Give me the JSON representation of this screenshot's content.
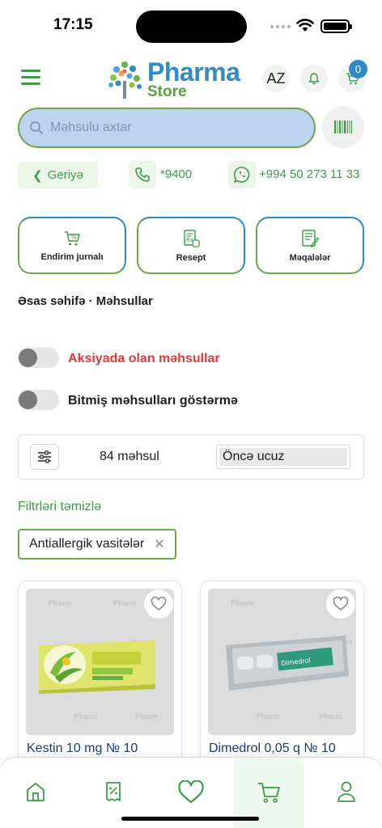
{
  "status_bar": {
    "time": "17:15"
  },
  "header": {
    "logo_line1": "Pharma",
    "logo_line2": "Store",
    "lang": "AZ",
    "cart_count": "0"
  },
  "search": {
    "placeholder": "Məhsulu axtar"
  },
  "contact": {
    "back_label": "Geriyə",
    "phone": "*9400",
    "whatsapp": "+994 50 273 11 33"
  },
  "quick_links": [
    {
      "label": "Endirim jurnalı",
      "icon": "discount-cart-icon"
    },
    {
      "label": "Resept",
      "icon": "prescription-icon"
    },
    {
      "label": "Məqalələr",
      "icon": "article-icon"
    }
  ],
  "breadcrumb": "Əsas səhifə · Məhsullar",
  "toggles": [
    {
      "label": "Aksiyada olan məhsullar",
      "on": false,
      "color": "#e03a3a"
    },
    {
      "label": "Bitmiş məhsulları göstərmə",
      "on": false
    }
  ],
  "listing": {
    "count_label": "84 məhsul",
    "sort_value": "Öncə ucuz",
    "clear_filters": "Filtrləri təmizlə",
    "active_filter": "Antiallergik vasitələr"
  },
  "products": [
    {
      "name": "Kestin 10 mg № 10",
      "watermark": "Pharm"
    },
    {
      "name": "Dimedrol 0,05 q № 10",
      "watermark": "Pharm"
    }
  ],
  "bottom_nav": [
    {
      "name": "home",
      "icon": "home-icon"
    },
    {
      "name": "discount",
      "icon": "discount-doc-icon"
    },
    {
      "name": "favorites",
      "icon": "heart-icon"
    },
    {
      "name": "cart",
      "icon": "cart-icon",
      "active": true
    },
    {
      "name": "profile",
      "icon": "user-icon"
    }
  ],
  "colors": {
    "green": "#3e9b4a",
    "blue": "#2f8bc4",
    "search_bg": "#bcd4ee",
    "red": "#e03a3a"
  }
}
